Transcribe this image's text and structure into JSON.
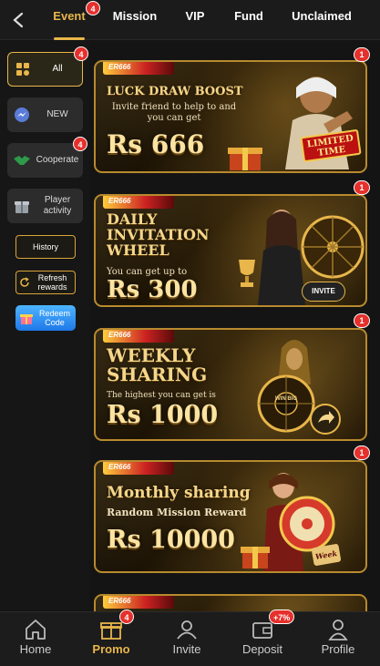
{
  "colors": {
    "accent": "#e8b64a",
    "badge": "#e5302c",
    "background": "#141414"
  },
  "top_tabs": [
    {
      "label": "Event",
      "active": true,
      "badge": "4"
    },
    {
      "label": "Mission"
    },
    {
      "label": "VIP"
    },
    {
      "label": "Fund"
    },
    {
      "label": "Unclaimed"
    }
  ],
  "sidebar": {
    "items": [
      {
        "label": "All",
        "icon": "grid-icon",
        "active": true,
        "badge": "4"
      },
      {
        "label": "NEW",
        "icon": "messenger-icon"
      },
      {
        "label": "Cooperate",
        "icon": "handshake-icon",
        "badge": "4"
      },
      {
        "label": "Player activity",
        "icon": "gift-icon"
      }
    ],
    "history_label": "History",
    "refresh_label": "Refresh rewards",
    "redeem_label": "Redeem Code"
  },
  "banners": [
    {
      "brand": "ER666",
      "title": "LUCK DRAW BOOST",
      "subtitle": "Invite friend to help to and you can get",
      "amount": "Rs 666",
      "tag": "LIMITED TIME",
      "badge": "1"
    },
    {
      "brand": "ER666",
      "title": "DAILY INVITATION WHEEL",
      "subtitle": "You can get up to",
      "amount": "Rs 300",
      "tag": "INVITE",
      "badge": "1"
    },
    {
      "brand": "ER666",
      "title": "WEEKLY SHARING",
      "subtitle": "The highest you can get is",
      "amount": "Rs 1000",
      "tag": "WIN BIG",
      "badge": "1"
    },
    {
      "brand": "ER666",
      "title": "Monthly sharing",
      "subtitle": "Random Mission Reward",
      "amount": "Rs 10000",
      "tag": "Week",
      "badge": "1"
    },
    {
      "brand": "ER666"
    }
  ],
  "bottom_nav": [
    {
      "label": "Home",
      "icon": "home-icon"
    },
    {
      "label": "Promo",
      "icon": "gift-icon",
      "active": true,
      "badge": "4"
    },
    {
      "label": "Invite",
      "icon": "users-icon"
    },
    {
      "label": "Deposit",
      "icon": "wallet-icon",
      "badge": "+7%"
    },
    {
      "label": "Profile",
      "icon": "profile-icon"
    }
  ]
}
